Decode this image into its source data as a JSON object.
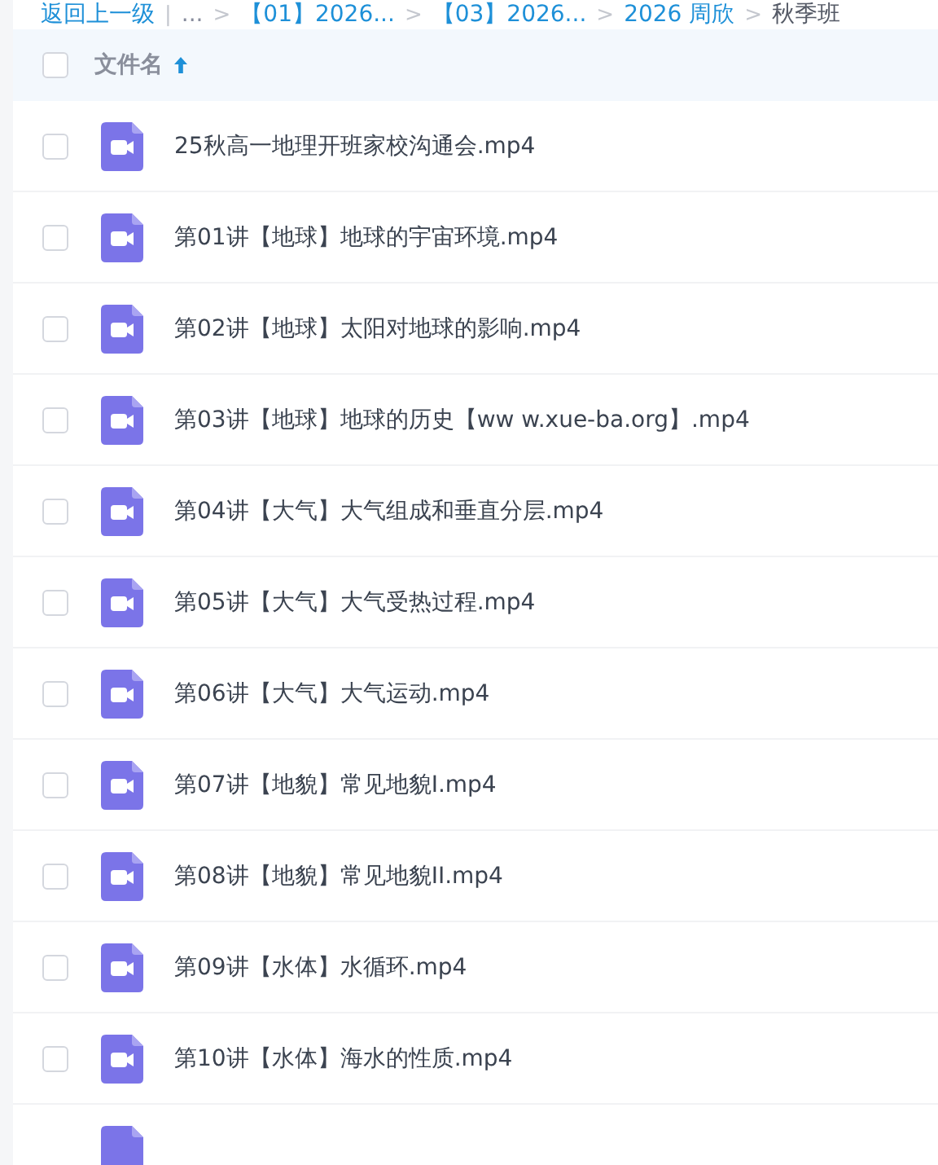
{
  "breadcrumb": {
    "back": "返回上一级",
    "divider": "|",
    "separator": ">",
    "items": [
      {
        "label": "...",
        "kind": "ellipsis"
      },
      {
        "label": "【01】2026...",
        "kind": "link"
      },
      {
        "label": "【03】2026...",
        "kind": "link"
      },
      {
        "label": "2026 周欣",
        "kind": "link"
      },
      {
        "label": "秋季班",
        "kind": "current"
      }
    ]
  },
  "header": {
    "checked": false,
    "column": "文件名"
  },
  "files": [
    {
      "name": "25秋高一地理开班家校沟通会.mp4",
      "checked": false
    },
    {
      "name": "第01讲【地球】地球的宇宙环境.mp4",
      "checked": false
    },
    {
      "name": "第02讲【地球】太阳对地球的影响.mp4",
      "checked": false
    },
    {
      "name": "第03讲【地球】地球的历史【ww w.xue-ba.org】.mp4",
      "checked": false
    },
    {
      "name": "第04讲【大气】大气组成和垂直分层.mp4",
      "checked": false
    },
    {
      "name": "第05讲【大气】大气受热过程.mp4",
      "checked": false
    },
    {
      "name": "第06讲【大气】大气运动.mp4",
      "checked": false
    },
    {
      "name": "第07讲【地貌】常见地貌I.mp4",
      "checked": false
    },
    {
      "name": "第08讲【地貌】常见地貌II.mp4",
      "checked": false
    },
    {
      "name": "第09讲【水体】水循环.mp4",
      "checked": false
    },
    {
      "name": "第10讲【水体】海水的性质.mp4",
      "checked": false
    }
  ]
}
